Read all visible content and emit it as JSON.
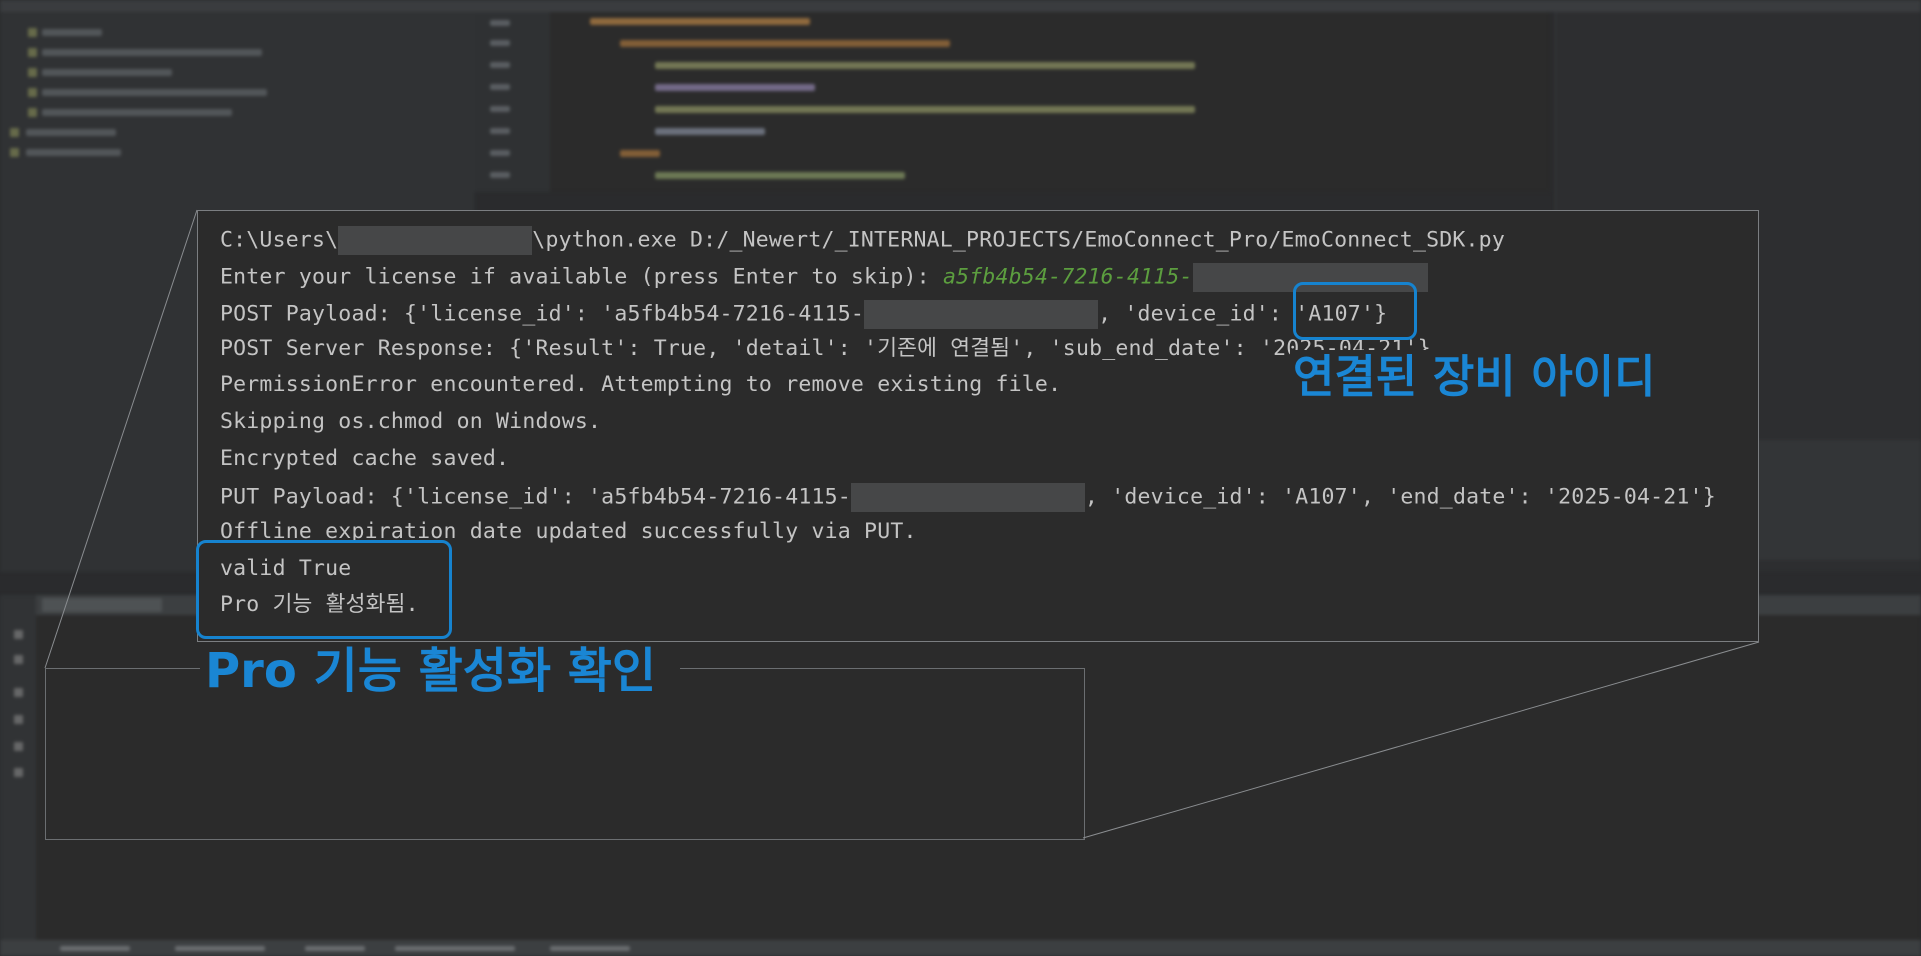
{
  "console": {
    "lines": [
      {
        "pre": "C:\\Users\\",
        "post": "\\python.exe D:/_Newert/_INTERNAL_PROJECTS/EmoConnect_Pro/EmoConnect_SDK.py"
      },
      {
        "text": "Enter your license if available (press Enter to skip): ",
        "input": "a5fb4b54-7216-4115-"
      },
      {
        "pre": "POST Payload: {'license_id': 'a5fb4b54-7216-4115-",
        "post": ", 'device_id': 'A107'}"
      },
      {
        "text": "POST Server Response: {'Result': True, 'detail': '기존에 연결됨', 'sub_end_date': '2025-04-21'}"
      },
      {
        "text": "PermissionError encountered. Attempting to remove existing file."
      },
      {
        "text": "Skipping os.chmod on Windows."
      },
      {
        "text": "Encrypted cache saved."
      },
      {
        "pre": "PUT Payload: {'license_id': 'a5fb4b54-7216-4115-",
        "post": ", 'device_id': 'A107', 'end_date': '2025-04-21'}"
      },
      {
        "text": "Offline expiration date updated successfully via PUT."
      },
      {
        "text": "valid True"
      },
      {
        "text": "Pro 기능 활성화됨."
      }
    ]
  },
  "annotations": {
    "device_callout": "연결된 장비 아이디",
    "pro_callout": "Pro 기능 활성화 확인"
  },
  "colors": {
    "highlight": "#1683cf",
    "console_bg": "#2b2b2b",
    "console_text": "#c4c4c4",
    "user_input": "#5c9e3f"
  }
}
